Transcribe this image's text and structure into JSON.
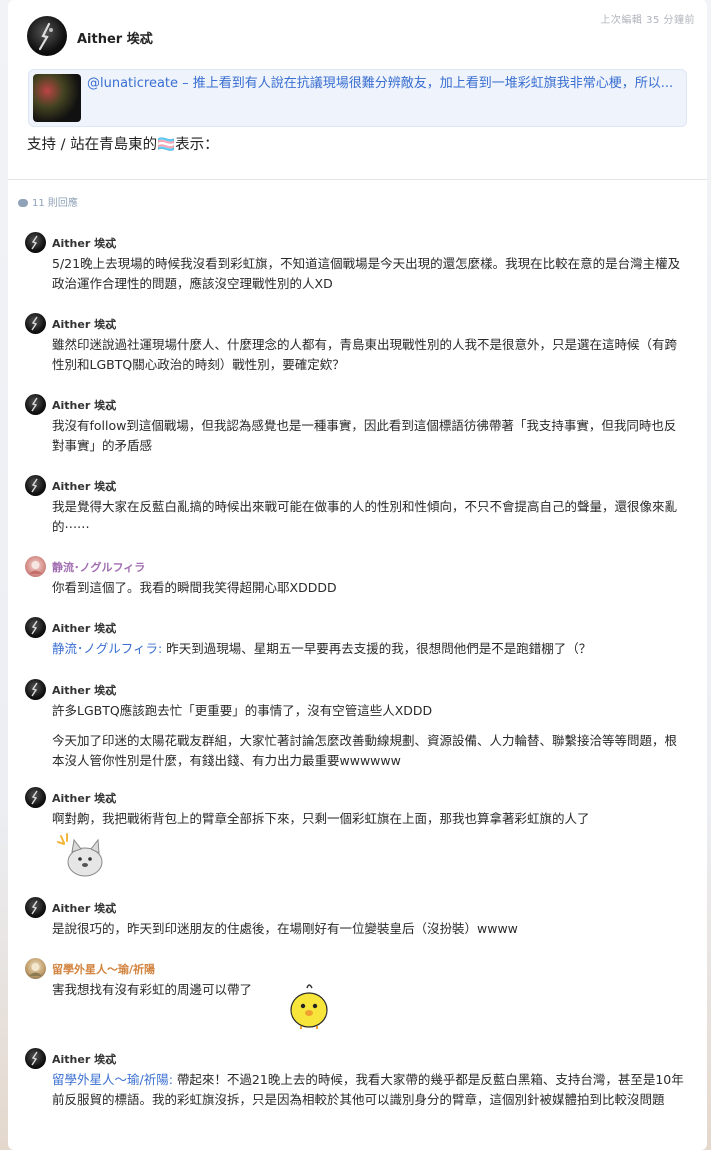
{
  "post": {
    "author": "Aither 埃忒",
    "edit_time": "上次編輯 35 分鐘前",
    "quote": "@lunaticreate – 推上看到有人說在抗議現場很難分辨敵友，加上看到一堆彩虹旗我非常心梗，所以...",
    "body_text": "支持 / 站在青島東的🏳‍⚧表示："
  },
  "reply_count": "11 則回應",
  "comments": [
    {
      "author": "Aither 埃忒",
      "paragraphs": [
        "5/21晚上去現場的時候我沒看到彩虹旗，不知道這個戰場是今天出現的還怎麼樣。我現在比較在意的是台灣主權及政治運作合理性的問題，應該沒空理戰性別的人XD"
      ]
    },
    {
      "author": "Aither 埃忒",
      "paragraphs": [
        "雖然印迷說過社運現場什麼人、什麼理念的人都有，青島東出現戰性別的人我不是很意外，只是選在這時候（有跨性別和LGBTQ關心政治的時刻）戰性別，要確定欸？"
      ]
    },
    {
      "author": "Aither 埃忒",
      "paragraphs": [
        "我沒有follow到這個戰場，但我認為感覺也是一種事實，因此看到這個標語彷彿帶著「我支持事實，但我同時也反對事實」的矛盾感"
      ]
    },
    {
      "author": "Aither 埃忒",
      "paragraphs": [
        "我是覺得大家在反藍白亂搞的時候出來戰可能在做事的人的性別和性傾向，不只不會提高自己的聲量，還很像來亂的⋯⋯"
      ]
    },
    {
      "author": "静流･ノグルフィラ",
      "paragraphs": [
        "你看到這個了。我看的瞬間我笑得超開心耶XDDDD"
      ]
    },
    {
      "author": "Aither 埃忒",
      "mention": "静流･ノグルフィラ:",
      "paragraphs": [
        " 昨天到過現場、星期五一早要再去支援的我，很想問他們是不是跑錯棚了（？"
      ]
    },
    {
      "author": "Aither 埃忒",
      "paragraphs": [
        "許多LGBTQ應該跑去忙「更重要」的事情了，沒有空管這些人XDDD",
        "今天加了印迷的太陽花戰友群組，大家忙著討論怎麼改善動線規劃、資源設備、人力輪替、聯繫接洽等等問題，根本沒人管你性別是什麼，有錢出錢、有力出力最重要wwwwww"
      ]
    },
    {
      "author": "Aither 埃忒",
      "paragraphs": [
        "啊對齁，我把戰術背包上的臂章全部拆下來，只剩一個彩虹旗在上面，那我也算拿著彩虹旗的人了"
      ]
    },
    {
      "author": "Aither 埃忒",
      "paragraphs": [
        "是說很巧的，昨天到印迷朋友的住處後，在場剛好有一位變裝皇后（沒扮裝）wwww"
      ]
    },
    {
      "author": "留學外星人～瑜/祈陽",
      "paragraphs": [
        "害我想找有沒有彩虹的周邊可以帶了"
      ]
    },
    {
      "author": "Aither 埃忒",
      "mention": "留學外星人～瑜/祈陽:",
      "paragraphs": [
        " 帶起來！不過21晚上去的時候，我看大家帶的幾乎都是反藍白黑箱、支持台灣，甚至是10年前反服貿的標語。我的彩虹旗沒拆，只是因為相較於其他可以識別身分的臂章，這個別針被媒體拍到比較沒問題"
      ]
    }
  ],
  "stickers": {
    "dog": "dog-sticker-icon",
    "chick": "chick-sticker-icon"
  }
}
